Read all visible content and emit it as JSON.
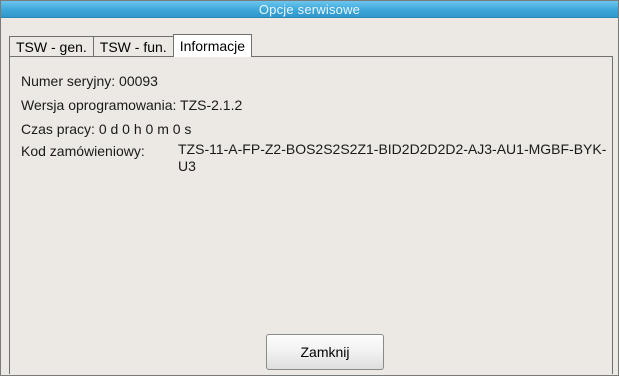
{
  "window": {
    "title": "Opcje serwisowe"
  },
  "tabs": [
    {
      "label": "TSW - gen.",
      "active": false
    },
    {
      "label": "TSW - fun.",
      "active": false
    },
    {
      "label": "Informacje",
      "active": true
    }
  ],
  "info": {
    "serial_label": "Numer seryjny:",
    "serial_value": "00093",
    "firmware_label": "Wersja oprogramowania:",
    "firmware_value": "TZS-2.1.2",
    "uptime_label": "Czas pracy:",
    "uptime_value": "0 d 0 h 0 m 0 s",
    "order_code_label": "Kod zamówieniowy:",
    "order_code_value": "TZS-11-A-FP-Z2-BOS2S2S2Z1-BID2D2D2D2-AJ3-AU1-MGBF-BYK-U3"
  },
  "buttons": {
    "close_label": "Zamknij"
  }
}
